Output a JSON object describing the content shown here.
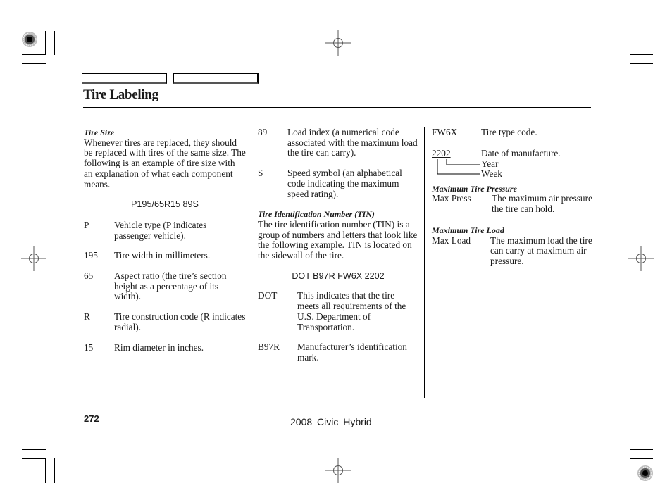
{
  "page": {
    "title": "Tire Labeling",
    "page_number": "272",
    "model": "2008  Civic  Hybrid"
  },
  "column1": {
    "heading": "Tire Size",
    "intro": "Whenever tires are replaced, they should be replaced with tires of the same size. The following is an example of tire size with an explanation of what each component means.",
    "example_code": "P195/65R15 89S",
    "definitions": [
      {
        "term": "P",
        "desc": "Vehicle type (P indicates passenger vehicle)."
      },
      {
        "term": "195",
        "desc": "Tire width in millimeters."
      },
      {
        "term": "65",
        "desc": "Aspect ratio (the tire’s section height as a percentage of its width)."
      },
      {
        "term": "R",
        "desc": "Tire construction code (R indicates radial)."
      },
      {
        "term": "15",
        "desc": "Rim diameter in inches."
      }
    ]
  },
  "column2": {
    "definitions": [
      {
        "term": "89",
        "desc": "Load index (a numerical code associated with the maximum load the tire can carry)."
      },
      {
        "term": "S",
        "desc": "Speed symbol (an alphabetical code indicating the maximum speed rating)."
      }
    ],
    "tin_heading": "Tire Identification Number (TIN)",
    "tin_intro": "The tire identification number (TIN) is a group of numbers and letters that look like the following example. TIN is located on the sidewall of the tire.",
    "tin_code": "DOT B97R FW6X 2202",
    "tin_definitions": [
      {
        "term": "DOT",
        "desc": "This indicates that the tire meets all requirements of the U.S. Department of Transportation."
      },
      {
        "term": "B97R",
        "desc": "Manufacturer’s identification mark."
      }
    ]
  },
  "column3": {
    "type_code": {
      "term": "FW6X",
      "desc": "Tire type code."
    },
    "date": {
      "term": "2202",
      "desc": "Date of manufacture.",
      "year_label": "Year",
      "week_label": "Week"
    },
    "pressure_heading": "Maximum Tire Pressure",
    "pressure": {
      "term": "Max Press",
      "desc": "The maximum air pressure the tire can hold."
    },
    "load_heading": "Maximum Tire Load",
    "load": {
      "term": "Max Load",
      "desc": "The maximum load the tire can carry at maximum air pressure."
    }
  }
}
